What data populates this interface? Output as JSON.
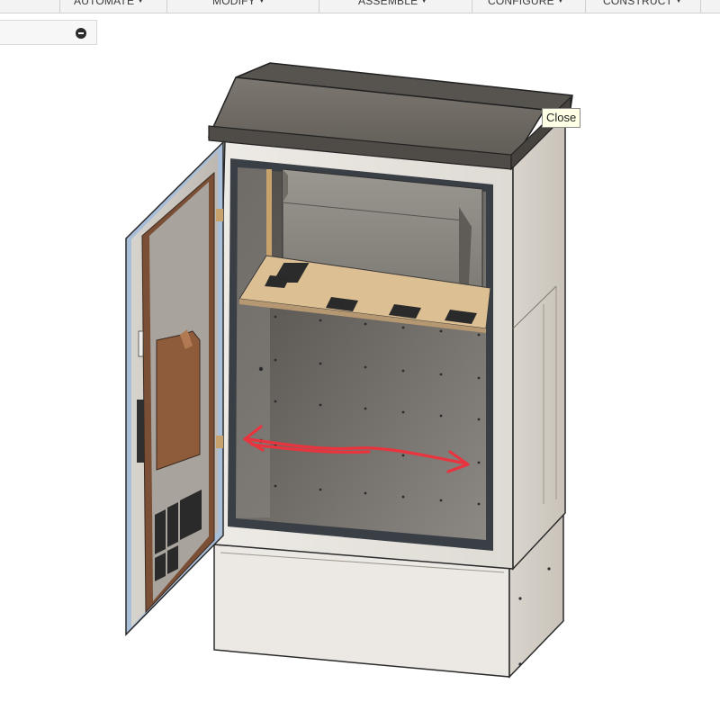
{
  "toolbar": {
    "items": [
      {
        "label": "AUTOMATE",
        "icon": "caret-down-icon"
      },
      {
        "label": "MODIFY",
        "icon": "caret-down-icon"
      },
      {
        "label": "ASSEMBLE",
        "icon": "caret-down-icon"
      },
      {
        "label": "CONFIGURE",
        "icon": "caret-down-icon"
      },
      {
        "label": "CONSTRUCT",
        "icon": "caret-down-icon"
      }
    ]
  },
  "browser": {
    "collapse_icon": "minus-circle-icon"
  },
  "tooltip": {
    "text": "Close"
  },
  "viewport": {
    "model": "outdoor-cabinet",
    "annotation": "double-headed-arrow",
    "colors": {
      "arrow": "#e8343f",
      "body": "#e8e5e0",
      "roof": "#6e6a63",
      "interior": "#5f5b56",
      "seal": "#3c4147",
      "door_edge": "#9fb4d0",
      "panel_brown": "#8a5a3c",
      "plate_tan": "#d8b98c"
    }
  }
}
